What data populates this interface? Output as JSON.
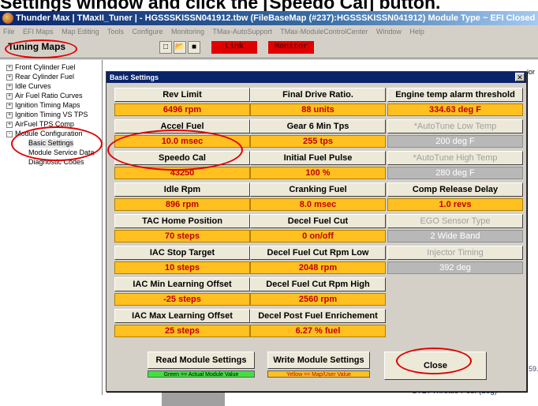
{
  "caption": "Settings window and click the [Speedo Cal] button.",
  "window": {
    "title": "Thunder Max  |  TMaxII_Tuner |  - HGSSSKISSN041912.tbw     (FileBaseMap (#237):HGSSSKISSN041912) Module Type ~ EFI Closed Loop"
  },
  "menu": [
    "File",
    "EFI Maps",
    "Map Editing",
    "Tools",
    "Configure",
    "Monitoring",
    "TMax-AutoSupport",
    "TMax-ModuleControlCenter",
    "Window",
    "Help"
  ],
  "toolbar": {
    "tuning_maps": "Tuning Maps",
    "new_icon": "□",
    "open_icon": "📂",
    "save_icon": "■",
    "link": "Link",
    "monitor": "Monitor"
  },
  "tree": [
    {
      "label": "Front Cylinder Fuel",
      "expander": "+"
    },
    {
      "label": "Rear Cylinder Fuel",
      "expander": "+"
    },
    {
      "label": "Idle Curves",
      "expander": "+"
    },
    {
      "label": "Air Fuel Ratio Curves",
      "expander": "+"
    },
    {
      "label": "Ignition Timing Maps",
      "expander": "+"
    },
    {
      "label": "Ignition Timing VS TPS",
      "expander": "+"
    },
    {
      "label": "AirFuel TPS Comp",
      "expander": "+"
    },
    {
      "label": "Module Configuration",
      "expander": "-"
    },
    {
      "label": "Basic Settings",
      "expander": ""
    },
    {
      "label": "Module Service Data",
      "expander": ""
    },
    {
      "label": "Diagnostic Codes",
      "expander": ""
    }
  ],
  "dialog": {
    "title": "Basic Settings",
    "close_x": "✕",
    "columns": [
      [
        {
          "label": "Rev Limit",
          "value": "6496 rpm",
          "disabled": false
        },
        {
          "label": "Accel Fuel",
          "value": "10.0 msec",
          "disabled": false
        },
        {
          "label": "Speedo Cal",
          "value": "43250",
          "disabled": false
        },
        {
          "label": "Idle Rpm",
          "value": "896 rpm",
          "disabled": false
        },
        {
          "label": "TAC Home Position",
          "value": "70 steps",
          "disabled": false
        },
        {
          "label": "IAC Stop Target",
          "value": "10 steps",
          "disabled": false
        },
        {
          "label": "IAC Min Learning Offset",
          "value": "-25 steps",
          "disabled": false
        },
        {
          "label": "IAC Max Learning Offset",
          "value": "25 steps",
          "disabled": false
        }
      ],
      [
        {
          "label": "Final Drive Ratio.",
          "value": "88 units",
          "disabled": false
        },
        {
          "label": "Gear 6 Min Tps",
          "value": "255 tps",
          "disabled": false
        },
        {
          "label": "Initial Fuel Pulse",
          "value": "100 %",
          "disabled": false
        },
        {
          "label": "Cranking Fuel",
          "value": "8.0 msec",
          "disabled": false
        },
        {
          "label": "Decel Fuel Cut",
          "value": "0 on/off",
          "disabled": false
        },
        {
          "label": "Decel Fuel Cut Rpm Low",
          "value": "2048 rpm",
          "disabled": false
        },
        {
          "label": "Decel Fuel Cut Rpm High",
          "value": "2560 rpm",
          "disabled": false
        },
        {
          "label": "Decel Post Fuel Enrichement",
          "value": "6.27 % fuel",
          "disabled": false
        }
      ],
      [
        {
          "label": "Engine temp alarm threshold",
          "value": "334.63 deg F",
          "disabled": false
        },
        {
          "label": "*AutoTune Low Temp",
          "value": "200 deg F",
          "disabled": true
        },
        {
          "label": "*AutoTune High Temp",
          "value": "280 deg F",
          "disabled": true
        },
        {
          "label": "Comp Release Delay",
          "value": "1.0 revs",
          "disabled": false
        },
        {
          "label": "EGO Sensor Type",
          "value": "2 Wide Band",
          "disabled": true
        },
        {
          "label": "Injector Timing",
          "value": "392 deg",
          "disabled": true
        }
      ]
    ],
    "read_button": "Read Module Settings",
    "read_legend": "Green == Actual Module Value",
    "write_button": "Write Module Settings",
    "write_legend": "Yellow == Map/User Value",
    "close_button": "Close"
  },
  "background": {
    "throttle_label": "STD. Throttle Pos. (deg)",
    "side_number": "59.",
    "side_text": "ior"
  }
}
